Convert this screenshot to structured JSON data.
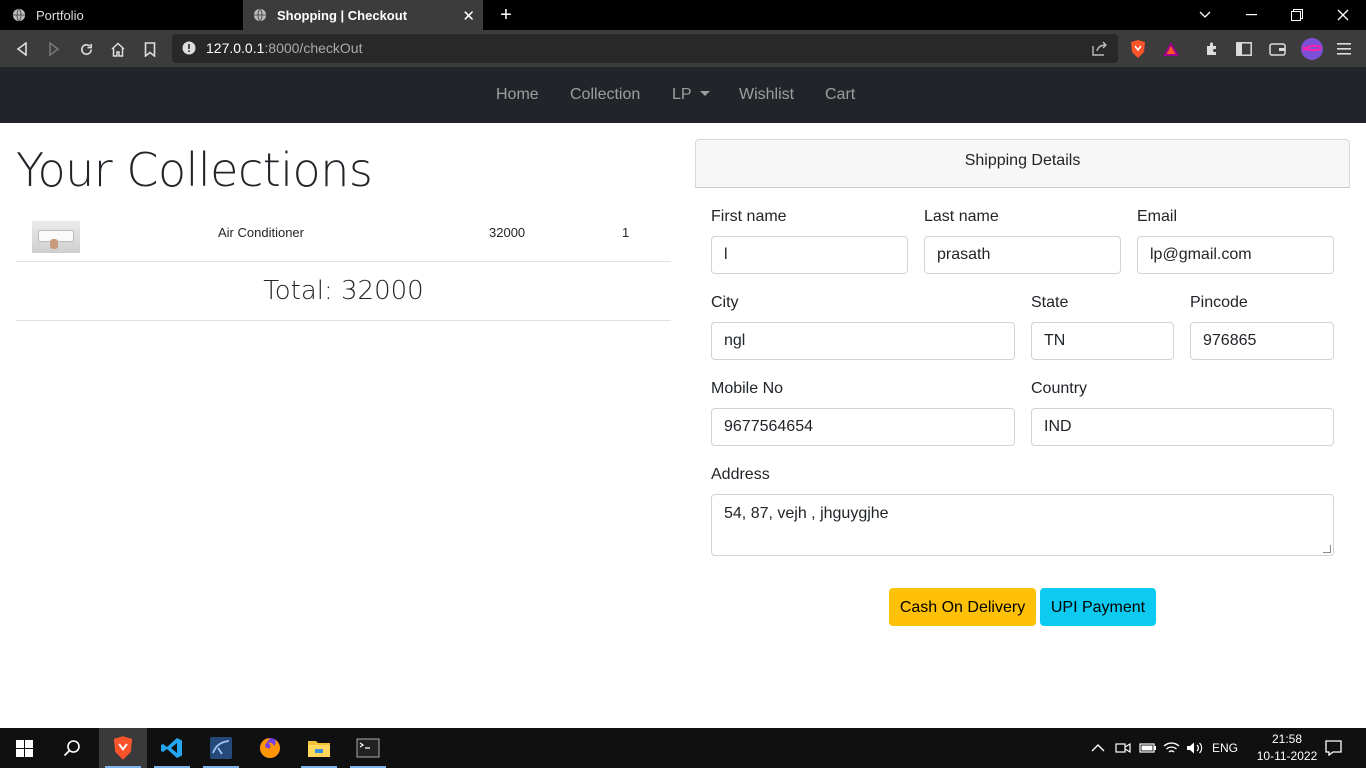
{
  "browser": {
    "tabs": [
      {
        "title": "Portfolio",
        "active": false
      },
      {
        "title": "Shopping | Checkout",
        "active": true
      }
    ],
    "url_host": "127.0.0.1",
    "url_path": ":8000/checkOut"
  },
  "nav": {
    "home": "Home",
    "collection": "Collection",
    "lp": "LP",
    "wishlist": "Wishlist",
    "cart": "Cart"
  },
  "collections": {
    "title": "Your Collections",
    "items": [
      {
        "name": "Air Conditioner",
        "price": "32000",
        "qty": "1"
      }
    ],
    "total": "Total: 32000"
  },
  "shipping": {
    "header": "Shipping Details",
    "first_name_label": "First name",
    "first_name": "l",
    "last_name_label": "Last name",
    "last_name": "prasath",
    "email_label": "Email",
    "email": "lp@gmail.com",
    "city_label": "City",
    "city": "ngl",
    "state_label": "State",
    "state": "TN",
    "pincode_label": "Pincode",
    "pincode": "976865",
    "mobile_label": "Mobile No",
    "mobile": "9677564654",
    "country_label": "Country",
    "country": "IND",
    "address_label": "Address",
    "address": "54, 87, vejh , jhguygjhe",
    "cod_button": "Cash On Delivery",
    "upi_button": "UPI Payment"
  },
  "taskbar": {
    "language": "ENG",
    "time": "21:58",
    "date": "10-11-2022"
  },
  "colors": {
    "navbar_bg": "#212529",
    "cod_button": "#ffc107",
    "upi_button": "#0dcaf0"
  }
}
